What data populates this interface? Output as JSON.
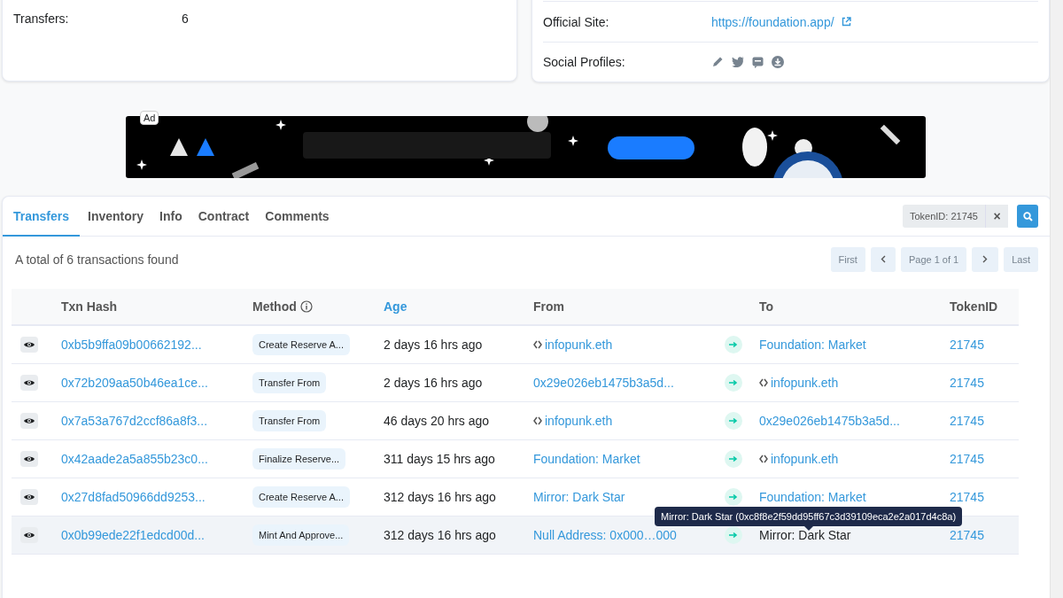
{
  "overview": {
    "rows": [
      {
        "label": "Transfers:",
        "value": "6"
      }
    ]
  },
  "profile": {
    "rows": [
      {
        "label": "Official Site:",
        "kind": "link",
        "value": "https://foundation.app/"
      },
      {
        "label": "Social Profiles:",
        "kind": "socials"
      }
    ]
  },
  "ad": {
    "label": "Ad",
    "kind": "picture"
  },
  "tabs": [
    {
      "label": "Transfers",
      "selected": true
    },
    {
      "label": "Inventory",
      "selected": false
    },
    {
      "label": "Info",
      "selected": false
    },
    {
      "label": "Contract",
      "selected": false
    },
    {
      "label": "Comments",
      "selected": false
    }
  ],
  "filter": {
    "value": "TokenID: 21745",
    "clear": "×"
  },
  "summary": "A total of 6 transactions found",
  "pagination": {
    "first": "First",
    "page": "Page 1 of 1",
    "last": "Last"
  },
  "table": {
    "columns": [
      {
        "label": "Txn Hash",
        "sorted": false
      },
      {
        "label": "Method",
        "sorted": false,
        "info": true
      },
      {
        "label": "Age",
        "sorted": true
      },
      {
        "label": "From",
        "sorted": false
      },
      {
        "label": "To",
        "sorted": false
      },
      {
        "label": "TokenID",
        "sorted": false
      }
    ],
    "rows": [
      {
        "hash": "0xb5b9ffa09b00662192...",
        "method": "Create Reserve A...",
        "age": "2 days 16 hrs ago",
        "from": {
          "text": "infopunk.eth",
          "contract": true,
          "link": true
        },
        "to": {
          "text": "Foundation: Market",
          "contract": false,
          "link": true
        },
        "token": "21745",
        "hovered": false
      },
      {
        "hash": "0x72b209aa50b46ea1ce...",
        "method": "Transfer From",
        "age": "2 days 16 hrs ago",
        "from": {
          "text": "0x29e026eb1475b3a5d...",
          "contract": false,
          "link": true
        },
        "to": {
          "text": "infopunk.eth",
          "contract": true,
          "link": true
        },
        "token": "21745",
        "hovered": false
      },
      {
        "hash": "0x7a53a767d2ccf86a8f3...",
        "method": "Transfer From",
        "age": "46 days 20 hrs ago",
        "from": {
          "text": "infopunk.eth",
          "contract": true,
          "link": true
        },
        "to": {
          "text": "0x29e026eb1475b3a5d...",
          "contract": false,
          "link": true
        },
        "token": "21745",
        "hovered": false
      },
      {
        "hash": "0x42aade2a5a855b23c0...",
        "method": "Finalize Reserve...",
        "age": "311 days 15 hrs ago",
        "from": {
          "text": "Foundation: Market",
          "contract": false,
          "link": true
        },
        "to": {
          "text": "infopunk.eth",
          "contract": true,
          "link": true
        },
        "token": "21745",
        "hovered": false
      },
      {
        "hash": "0x27d8fad50966dd9253...",
        "method": "Create Reserve A...",
        "age": "312 days 16 hrs ago",
        "from": {
          "text": "Mirror: Dark Star",
          "contract": false,
          "link": true
        },
        "to": {
          "text": "Foundation: Market",
          "contract": false,
          "link": true
        },
        "token": "21745",
        "hovered": false
      },
      {
        "hash": "0x0b99ede22f1edcd00d...",
        "method": "Mint And Approve...",
        "age": "312 days 16 hrs ago",
        "from": {
          "text": "Null Address: 0x000…000",
          "contract": false,
          "link": true
        },
        "to": {
          "text": "Mirror: Dark Star",
          "contract": false,
          "link": false,
          "tooltip": "Mirror: Dark Star (0xc8f8e2f59dd95ff67c3d39109eca2e2a017d4c8a)"
        },
        "token": "21745",
        "hovered": true
      }
    ]
  }
}
